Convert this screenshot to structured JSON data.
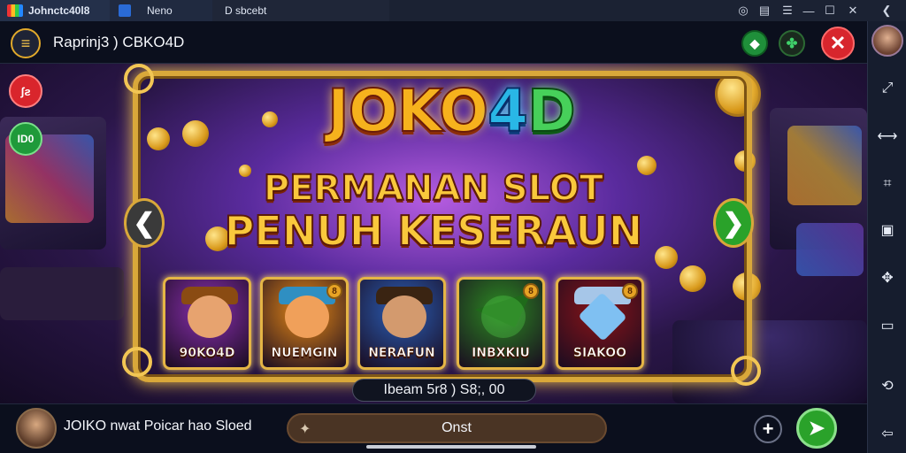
{
  "titlebar": {
    "tabs": [
      {
        "label": "Johnctc40l8"
      },
      {
        "label": "Neno"
      },
      {
        "label": "D sbcebt"
      }
    ],
    "controls": [
      "record-icon",
      "page-icon",
      "menu-icon",
      "minimize-icon",
      "maximize-icon",
      "close-icon",
      "back-icon"
    ]
  },
  "header": {
    "title": "Raprinj3 ) CBKO4D",
    "icons": [
      "menu-icon",
      "diamond-icon",
      "clover-icon",
      "close-icon"
    ],
    "colors": {
      "accent_green": "#1f8f3a",
      "close_red": "#d7262d"
    }
  },
  "left_buttons": [
    {
      "label": "ʃƨ",
      "color": "#d9252c"
    },
    {
      "label": "ID0",
      "color": "#1f9a3a"
    }
  ],
  "banner": {
    "logo_parts": [
      "JOKO",
      "4",
      "D"
    ],
    "headline_1": "PERMANAN SLOT",
    "headline_2": "PENUH KESERAUN",
    "prev_icon": "chevron-left-icon",
    "next_icon": "chevron-right-icon"
  },
  "games": [
    {
      "label": "90KO4D",
      "bg": "#8a2fb0",
      "face": "#e7a36f",
      "hat": "#8a4b12",
      "badge": ""
    },
    {
      "label": "NUEMGIN",
      "bg": "#e98a16",
      "face": "#f0a05a",
      "hat": "#2f8fc2",
      "badge": "8"
    },
    {
      "label": "NERAFUN",
      "bg": "#2a5fb8",
      "face": "#d39a6e",
      "hat": "#3a2412",
      "badge": ""
    },
    {
      "label": "INBXKIU",
      "bg": "#2c8a22",
      "face": "#52d24a",
      "hat": "#1f6a1a",
      "badge": "8"
    },
    {
      "label": "SIAKOO",
      "bg": "#8a1418",
      "face": "#7fc0f2",
      "hat": "#a6c6e8",
      "badge": "8"
    }
  ],
  "balance": "Ibeam 5r8 )  S8;, 00",
  "bottom": {
    "message": "JOIKO  nwat Poicar hao Sloed",
    "chat_placeholder": "Onst",
    "add_icon": "plus-icon",
    "send_icon": "send-arrow-icon"
  },
  "sidebar": {
    "icons": [
      "expand-icon",
      "link-icon",
      "crop-icon",
      "screenshot-icon",
      "move-icon",
      "folder-icon",
      "shake-icon",
      "back-arrow-icon"
    ]
  }
}
